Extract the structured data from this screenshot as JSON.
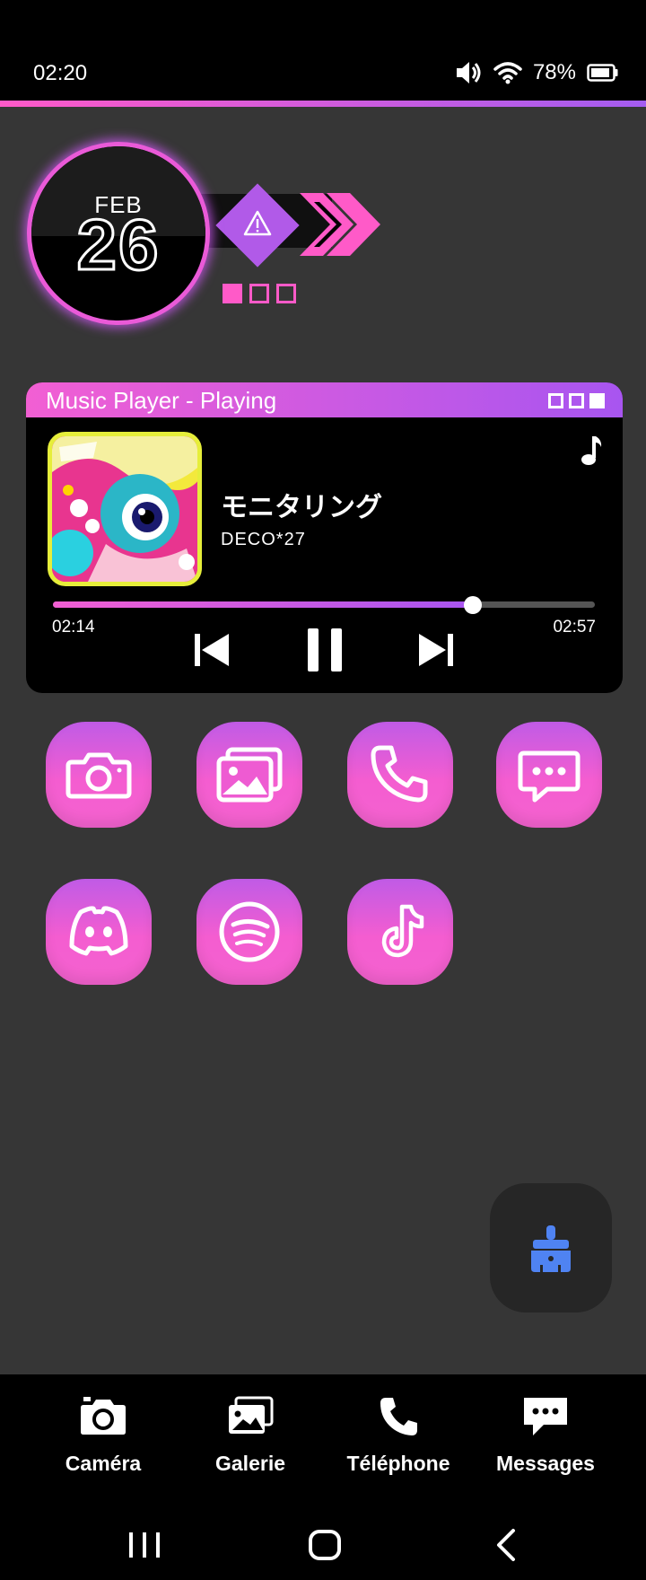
{
  "status_bar": {
    "time": "02:20",
    "battery": "78%",
    "icons": [
      "volume-icon",
      "wifi-icon",
      "battery-icon"
    ]
  },
  "date_widget": {
    "month": "FEB",
    "day": "26",
    "icons": [
      "warning-icon",
      "chevrons-icon"
    ],
    "page_indicator": {
      "total": 3,
      "active": 1
    }
  },
  "music_player": {
    "header": "Music Player - Playing",
    "song_title": "モニタリング",
    "artist": "DECO*27",
    "elapsed": "02:14",
    "duration": "02:57",
    "progress_fraction": 0.775,
    "controls": [
      "previous-icon",
      "pause-icon",
      "next-icon"
    ]
  },
  "home_apps": [
    {
      "name": "camera",
      "icon": "camera-icon"
    },
    {
      "name": "gallery",
      "icon": "gallery-icon"
    },
    {
      "name": "phone",
      "icon": "phone-icon"
    },
    {
      "name": "messages",
      "icon": "chat-icon"
    },
    {
      "name": "discord",
      "icon": "discord-icon"
    },
    {
      "name": "spotify",
      "icon": "spotify-icon"
    },
    {
      "name": "tiktok",
      "icon": "tiktok-icon"
    }
  ],
  "dock": {
    "items": [
      {
        "label": "Caméra",
        "icon": "camera-icon"
      },
      {
        "label": "Galerie",
        "icon": "gallery-icon"
      },
      {
        "label": "Téléphone",
        "icon": "phone-icon"
      },
      {
        "label": "Messages",
        "icon": "chat-icon"
      }
    ]
  },
  "colors": {
    "accent_pink": "#ff5ac8",
    "accent_purple": "#a45cf0",
    "background": "#363636",
    "cleaner_blue": "#4f83f2"
  }
}
